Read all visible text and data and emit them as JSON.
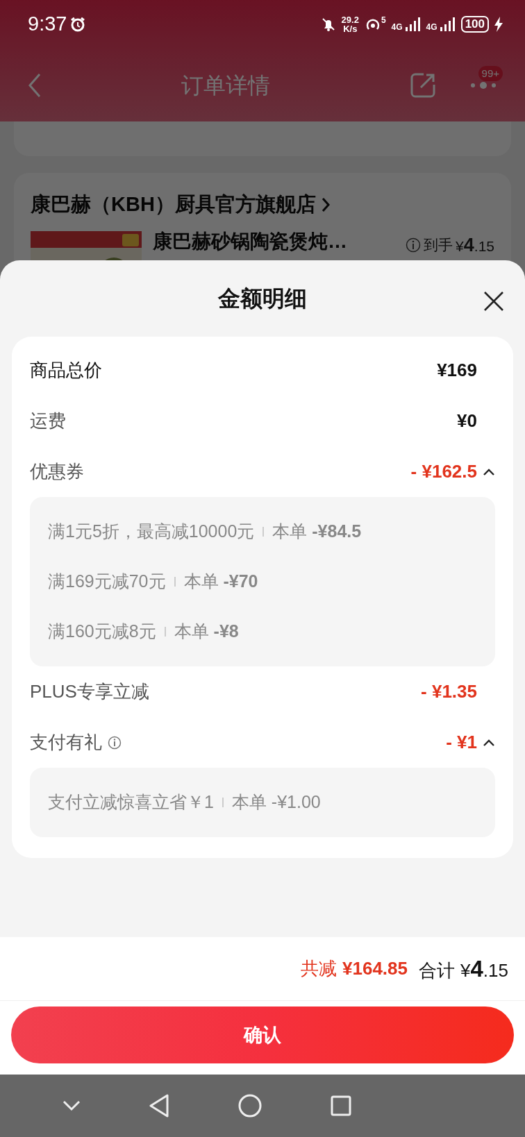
{
  "status_bar": {
    "time": "9:37",
    "net_speed_value": "29.2",
    "net_speed_unit": "K/s",
    "hotspot_count": "5",
    "network_1": "4G",
    "network_2": "4G",
    "battery": "100"
  },
  "header": {
    "title": "订单详情",
    "badge": "99+"
  },
  "store": {
    "name": "康巴赫（KBH）厨具官方旗舰店",
    "product": {
      "name": "康巴赫砂锅陶瓷煲炖…",
      "price_label": "到手",
      "price": "¥**4**.15"
    }
  },
  "sheet": {
    "title": "金额明细",
    "rows": [
      {
        "kind": "line",
        "label": "商品总价",
        "value": "¥169"
      },
      {
        "kind": "line",
        "label": "运费",
        "value": "¥0"
      },
      {
        "kind": "discount",
        "label": "优惠券",
        "value": "- ¥162.5",
        "info": false,
        "expanded": true,
        "details": [
          {
            "condition": "满1元5折，最高减10000元",
            "amount": "本单 **-¥84.5**"
          },
          {
            "condition": "满169元减70元",
            "amount": "本单 **-¥70**"
          },
          {
            "condition": "满160元减8元",
            "amount": "本单 **-¥8**"
          }
        ]
      },
      {
        "kind": "discount",
        "label": "PLUS专享立减",
        "value": "- ¥1.35",
        "info": false
      },
      {
        "kind": "discount",
        "label": "支付有礼",
        "value": "- ¥1",
        "info": true,
        "expanded": true,
        "details": [
          {
            "condition": "支付立减惊喜立省￥1",
            "amount": "本单 -¥1.00"
          }
        ]
      }
    ]
  },
  "footer": {
    "saved_label": "共减",
    "saved_value": "¥164.85",
    "total_label": "合计",
    "total_value": "¥**4**.15",
    "confirm": "确认"
  }
}
